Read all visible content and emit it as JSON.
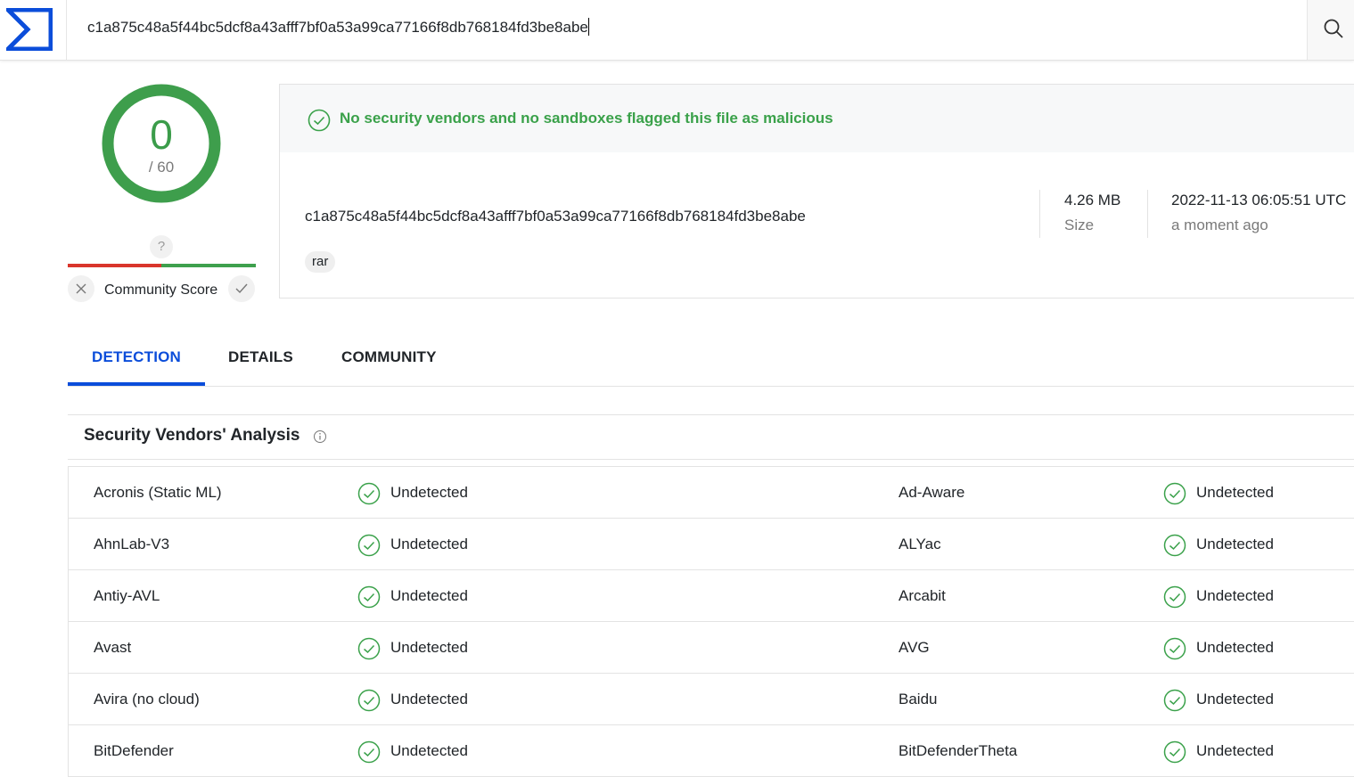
{
  "search": {
    "value": "c1a875c48a5f44bc5dcf8a43afff7bf0a53a99ca77166f8db768184fd3be8abe"
  },
  "score": {
    "detections": "0",
    "total": "/ 60"
  },
  "community": {
    "unknown": "?",
    "label": "Community Score"
  },
  "banner": {
    "message": "No security vendors and no sandboxes flagged this file as malicious"
  },
  "file": {
    "hash": "c1a875c48a5f44bc5dcf8a43afff7bf0a53a99ca77166f8db768184fd3be8abe",
    "tag": "rar",
    "size_value": "4.26 MB",
    "size_label": "Size",
    "date_value": "2022-11-13 06:05:51 UTC",
    "date_label": "a moment ago"
  },
  "tabs": [
    {
      "label": "DETECTION"
    },
    {
      "label": "DETAILS"
    },
    {
      "label": "COMMUNITY"
    }
  ],
  "section": {
    "title": "Security Vendors' Analysis"
  },
  "vendors": [
    {
      "left": "Acronis (Static ML)",
      "left_status": "Undetected",
      "right": "Ad-Aware",
      "right_status": "Undetected"
    },
    {
      "left": "AhnLab-V3",
      "left_status": "Undetected",
      "right": "ALYac",
      "right_status": "Undetected"
    },
    {
      "left": "Antiy-AVL",
      "left_status": "Undetected",
      "right": "Arcabit",
      "right_status": "Undetected"
    },
    {
      "left": "Avast",
      "left_status": "Undetected",
      "right": "AVG",
      "right_status": "Undetected"
    },
    {
      "left": "Avira (no cloud)",
      "left_status": "Undetected",
      "right": "Baidu",
      "right_status": "Undetected"
    },
    {
      "left": "BitDefender",
      "left_status": "Undetected",
      "right": "BitDefenderTheta",
      "right_status": "Undetected"
    }
  ],
  "colors": {
    "accent": "#0b4dda",
    "clean": "#3aa14a",
    "malicious": "#d9352b"
  }
}
